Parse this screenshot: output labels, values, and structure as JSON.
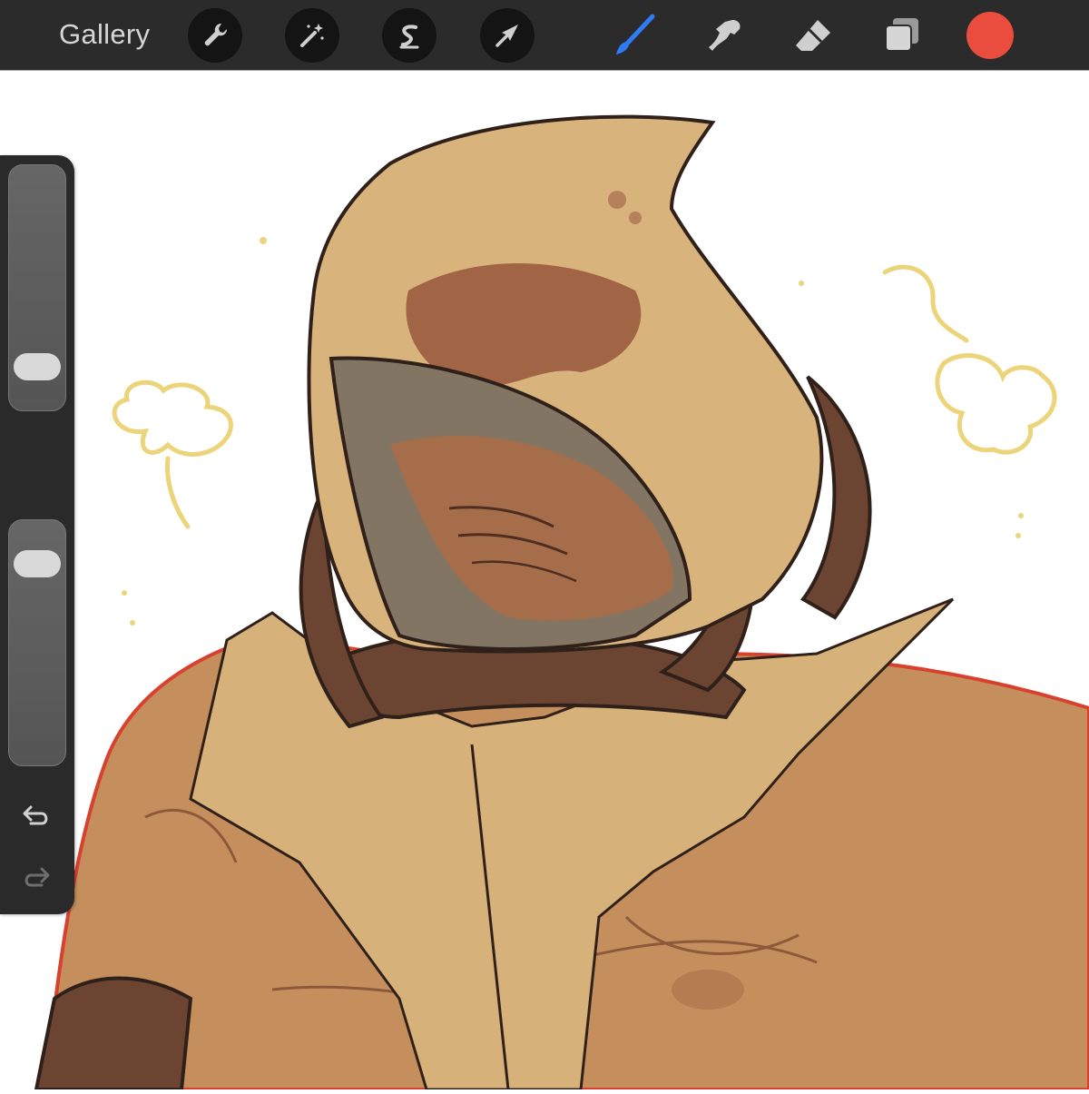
{
  "toolbar": {
    "gallery_label": "Gallery",
    "icons": [
      "wrench-icon",
      "magic-wand-icon",
      "selection-icon",
      "transform-arrow-icon",
      "brush-icon",
      "smudge-icon",
      "eraser-icon",
      "layers-icon"
    ],
    "active_tool": "brush",
    "active_tool_color": "#2f7bf5",
    "current_color": "#ea4c3d"
  },
  "sidebar": {
    "brush_size_level": 0.12,
    "opacity_level": 0.88,
    "controls": [
      "brush-size-slider",
      "modify-button",
      "opacity-slider",
      "undo-button",
      "redo-button"
    ]
  },
  "canvas": {
    "background": "#ffffff",
    "artwork": "hooded-warrior-illustration"
  }
}
